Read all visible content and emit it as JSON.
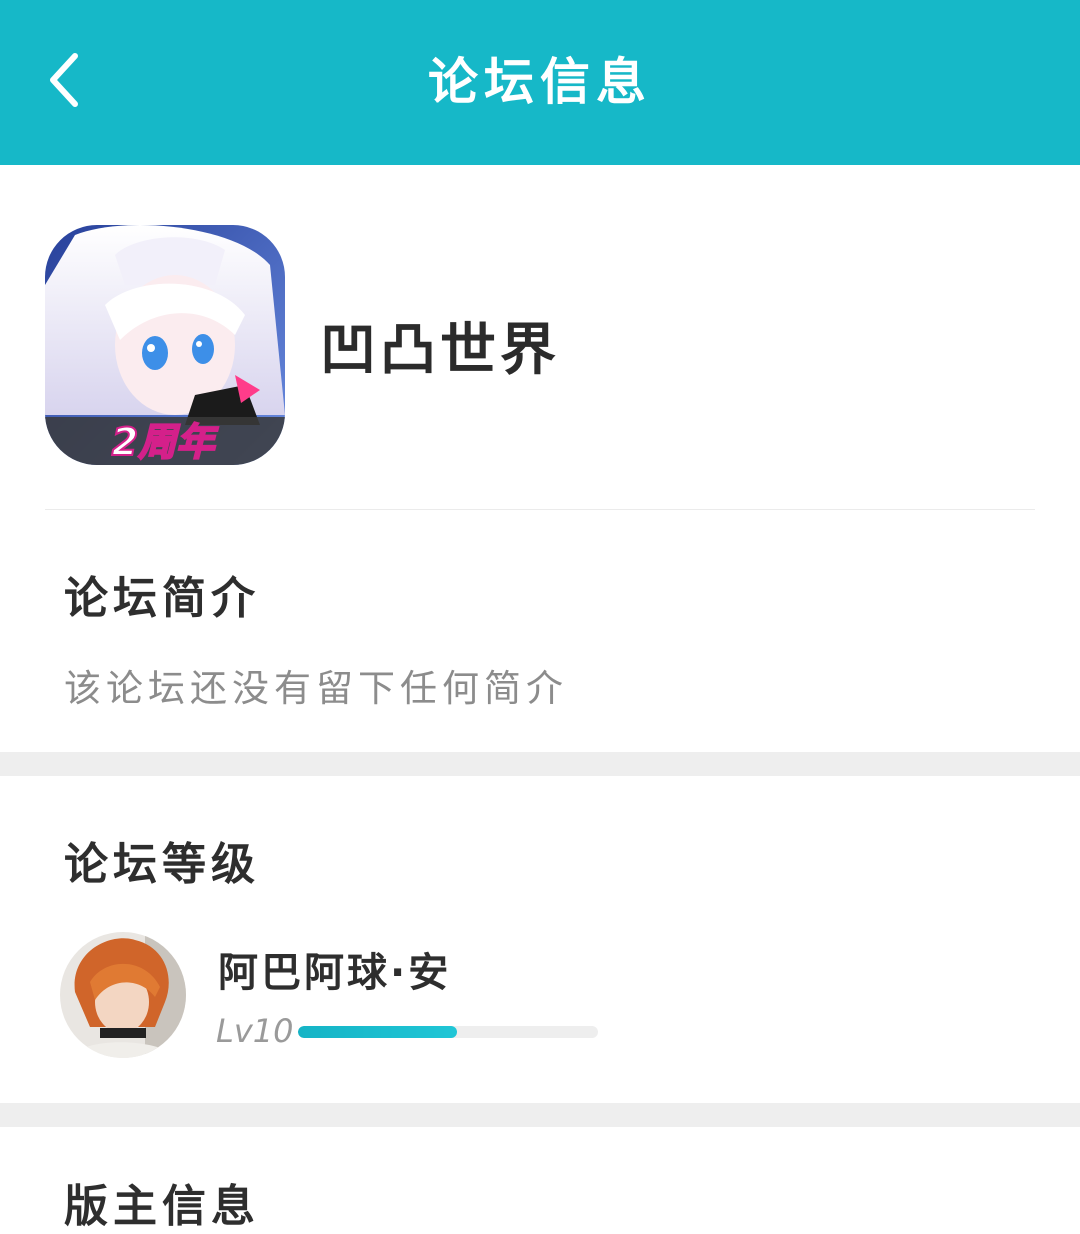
{
  "header": {
    "title": "论坛信息",
    "back_icon": "chevron-left-icon",
    "background_color": "#16b8c8"
  },
  "forum": {
    "name": "凹凸世界",
    "icon_badge_text": "2周年"
  },
  "intro": {
    "title": "论坛简介",
    "text": "该论坛还没有留下任何简介"
  },
  "level": {
    "title": "论坛等级",
    "user_name": "阿巴阿球·安",
    "level_label": "Lv10",
    "progress": 0.53
  },
  "next_section": {
    "title": "版主信息"
  }
}
